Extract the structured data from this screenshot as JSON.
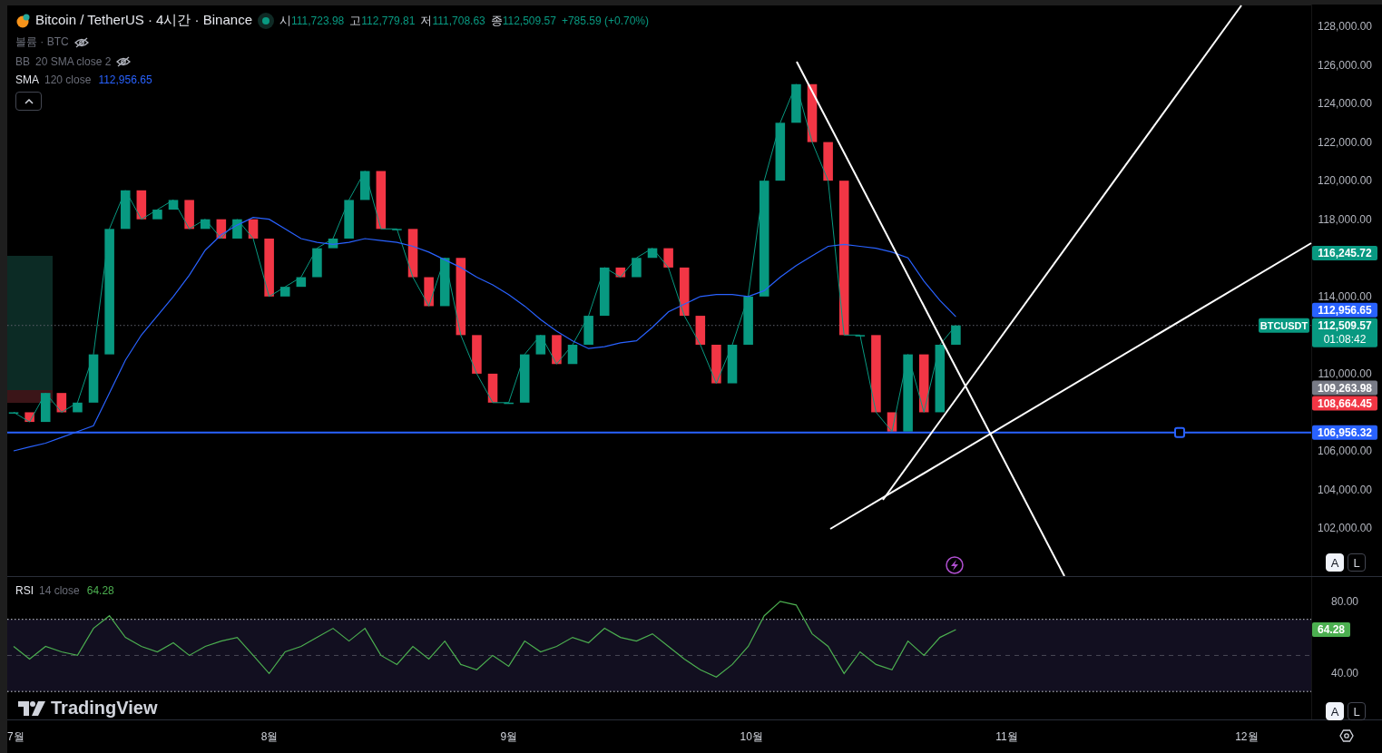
{
  "symbol": {
    "title": "Bitcoin / TetherUS · 4시간 · Binance",
    "market_open": true,
    "ohlc": [
      {
        "label": "시",
        "value": "111,723.98"
      },
      {
        "label": "고",
        "value": "112,779.81"
      },
      {
        "label": "저",
        "value": "111,708.63"
      },
      {
        "label": "종",
        "value": "112,509.57"
      }
    ],
    "change": "+785.59 (+0.70%)"
  },
  "indicators": [
    {
      "name": "볼륨 · BTC",
      "visible": false
    },
    {
      "name": "BB",
      "params": "20 SMA close 2",
      "visible": false
    },
    {
      "name": "SMA",
      "params": "120 close",
      "value": "112,956.65",
      "visible": true
    }
  ],
  "price_pane": {
    "scale_buttons": [
      {
        "label": "A",
        "selected": true
      },
      {
        "label": "L",
        "selected": false
      }
    ],
    "last_price": {
      "label": "112,509.57",
      "countdown": "01:08:42"
    },
    "axis_badges": [
      {
        "label": "116,245.72",
        "color": "#089981"
      },
      {
        "label": "112,956.65",
        "color": "#2962ff"
      },
      {
        "label": "109,263.98",
        "color": "#787b86"
      },
      {
        "label": "108,664.45",
        "color": "#f23645"
      },
      {
        "label": "106,956.32",
        "color": "#2962ff"
      }
    ],
    "chart_data": {
      "type": "line",
      "ylim": [
        99513,
        129126
      ],
      "categories": [
        null,
        null,
        null,
        null,
        null,
        null,
        null,
        null,
        null,
        null,
        null,
        null,
        null,
        null,
        null,
        null,
        null,
        null,
        null,
        null,
        null,
        null,
        null,
        null,
        null,
        null,
        null,
        null,
        null,
        null,
        null,
        null,
        null,
        null,
        null,
        null,
        null,
        null,
        null,
        null,
        null,
        null,
        null,
        null,
        null,
        null,
        null,
        null,
        null,
        null,
        null,
        null,
        null,
        null,
        null,
        null,
        null,
        null,
        null,
        null,
        null,
        null,
        null,
        null,
        null,
        null,
        null,
        null,
        null,
        null,
        null,
        null,
        null,
        null,
        null,
        null,
        null,
        null,
        null,
        null,
        null,
        null
      ],
      "series": [
        {
          "name": "BTCUSDT",
          "color": "#089981",
          "values": [
            108000,
            107500,
            109000,
            108000,
            108500,
            111000,
            117500,
            119500,
            118000,
            118500,
            119000,
            117500,
            118000,
            117000,
            118000,
            117000,
            114000,
            114500,
            115000,
            116500,
            117000,
            119000,
            120500,
            117500,
            117500,
            115000,
            113500,
            116000,
            112000,
            110000,
            108500,
            108500,
            111000,
            112000,
            110500,
            111500,
            113000,
            115500,
            115000,
            116000,
            116500,
            115500,
            113000,
            111500,
            109500,
            111500,
            114000,
            120000,
            123000,
            125000,
            122000,
            120000,
            112000,
            112000,
            108000,
            107000,
            111000,
            108000,
            111500,
            112500,
            null,
            null,
            null,
            null,
            null,
            null,
            null,
            null,
            null,
            null,
            null,
            null,
            null,
            null,
            null,
            null,
            null,
            null,
            null,
            null,
            null,
            null
          ]
        },
        {
          "color": "#2962ff",
          "values": [
            106000,
            106200,
            106400,
            106700,
            107000,
            107300,
            109000,
            110700,
            112000,
            113000,
            114000,
            115100,
            116400,
            117200,
            117700,
            118100,
            118000,
            117500,
            117000,
            116800,
            116700,
            116800,
            117000,
            116900,
            116800,
            116600,
            116300,
            115900,
            115500,
            115000,
            114600,
            114100,
            113500,
            112800,
            112200,
            111700,
            111300,
            111400,
            111600,
            111700,
            112400,
            113200,
            113600,
            114000,
            114100,
            114100,
            114000,
            114300,
            115000,
            115600,
            116100,
            116600,
            116700,
            116600,
            116500,
            116300,
            116000,
            114800,
            113800,
            112950,
            null,
            null,
            null,
            null,
            null,
            null,
            null,
            null,
            null,
            null,
            null,
            null,
            null,
            null,
            null,
            null,
            null,
            null,
            null,
            null,
            null,
            null
          ]
        }
      ],
      "yticks": [
        {
          "value": 128000,
          "label": "128,000.00"
        },
        {
          "value": 126000,
          "label": "126,000.00"
        },
        {
          "value": 124000,
          "label": "124,000.00"
        },
        {
          "value": 122000,
          "label": "122,000.00"
        },
        {
          "value": 120000,
          "label": "120,000.00"
        },
        {
          "value": 118000,
          "label": "118,000.00"
        },
        {
          "value": 114000,
          "label": "114,000.00"
        },
        {
          "value": 110000,
          "label": "110,000.00"
        },
        {
          "value": 106000,
          "label": "106,000.00"
        },
        {
          "value": 104000,
          "label": "104,000.00"
        },
        {
          "value": 102000,
          "label": "102,000.00"
        }
      ]
    }
  },
  "rsi_pane": {
    "indicator": {
      "name": "RSI",
      "params": "14 close",
      "value": "64.28",
      "visible": true
    },
    "value_badge": {
      "label": "64.28",
      "color": "#4caf50"
    },
    "scale_buttons": [
      {
        "label": "A",
        "selected": true
      },
      {
        "label": "L",
        "selected": false
      }
    ],
    "chart_data": {
      "type": "line",
      "ylim": [
        14.5,
        93.5
      ],
      "categories": [
        "7월",
        null,
        null,
        null,
        null,
        null,
        null,
        null,
        null,
        null,
        null,
        null,
        null,
        null,
        null,
        null,
        "8월",
        null,
        null,
        null,
        null,
        null,
        null,
        null,
        null,
        null,
        null,
        null,
        null,
        null,
        null,
        "9월",
        null,
        null,
        null,
        null,
        null,
        null,
        null,
        null,
        null,
        null,
        null,
        null,
        null,
        null,
        "10월",
        null,
        null,
        null,
        null,
        null,
        null,
        null,
        null,
        null,
        null,
        null,
        null,
        null,
        null,
        null,
        "11월",
        null,
        null,
        null,
        null,
        null,
        null,
        null,
        null,
        null,
        null,
        null,
        null,
        null,
        null,
        "12월",
        null,
        null,
        null,
        null
      ],
      "series": [
        {
          "color": "#4caf50",
          "values": [
            55,
            48,
            55,
            52,
            50,
            65,
            72,
            60,
            55,
            52,
            57,
            50,
            55,
            58,
            60,
            50,
            40,
            52,
            55,
            60,
            65,
            58,
            65,
            50,
            45,
            55,
            48,
            58,
            45,
            42,
            50,
            44,
            58,
            52,
            55,
            60,
            57,
            65,
            60,
            58,
            62,
            55,
            48,
            42,
            38,
            45,
            55,
            72,
            80,
            78,
            62,
            55,
            40,
            52,
            45,
            42,
            58,
            50,
            60,
            64.3,
            null,
            null,
            null,
            null,
            null,
            null,
            null,
            null,
            null,
            null,
            null,
            null,
            null,
            null,
            null,
            null,
            null,
            null,
            null,
            null,
            null,
            null
          ]
        }
      ],
      "yticks": [
        {
          "value": 80,
          "label": "80.00"
        },
        {
          "value": 40,
          "label": "40.00"
        }
      ]
    }
  },
  "logo": {
    "text": "TradingView"
  }
}
